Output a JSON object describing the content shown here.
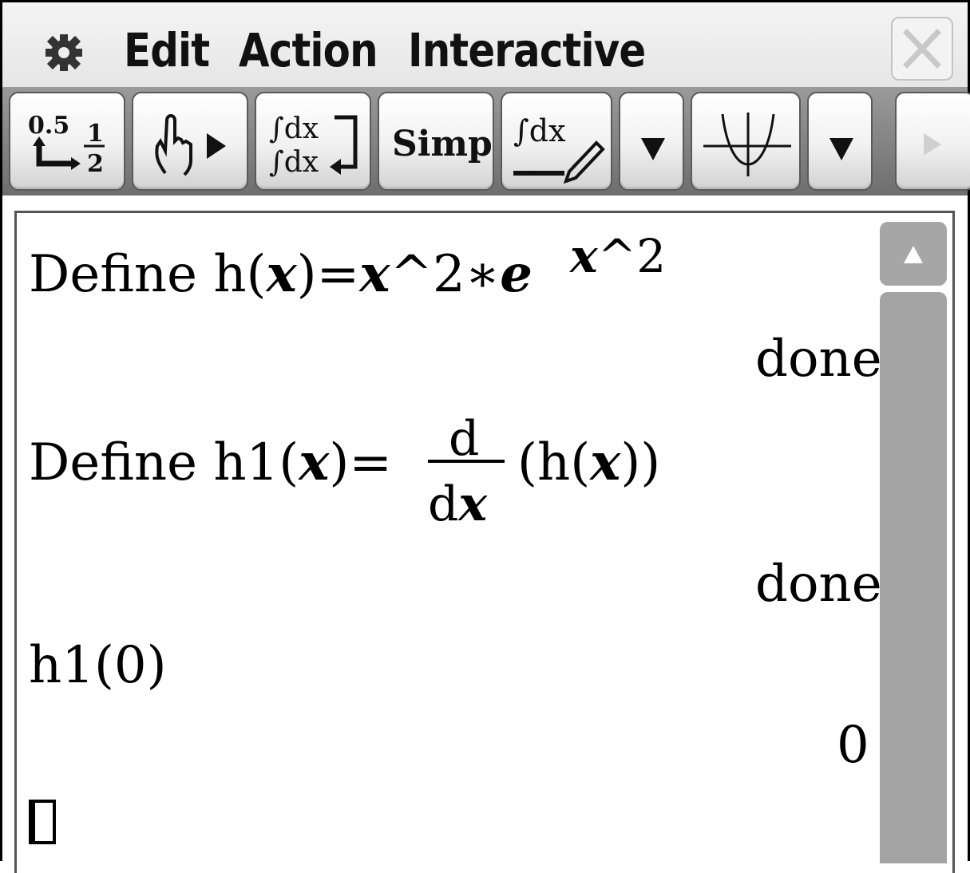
{
  "menu": {
    "settings_icon": "gear-icon",
    "items": [
      "Edit",
      "Action",
      "Interactive"
    ],
    "close_icon": "close-icon"
  },
  "toolbar": {
    "buttons": [
      {
        "name": "decimal-fraction-toggle-button",
        "label_top": "0.5",
        "label_frac_num": "1",
        "label_frac_den": "2"
      },
      {
        "name": "pan-hand-button"
      },
      {
        "name": "integral-toggle-button",
        "label_top": "∫dx",
        "label_bottom": "∫dx"
      },
      {
        "name": "simplify-button",
        "label": "Simp"
      },
      {
        "name": "integral-edit-button",
        "label": "∫dx"
      },
      {
        "name": "dropdown-arrow-1"
      },
      {
        "name": "graph-button"
      },
      {
        "name": "dropdown-arrow-2"
      },
      {
        "name": "toolbar-next-button"
      }
    ]
  },
  "history": {
    "entry1": {
      "prefix": "Define  h(",
      "x1": "x",
      "mid": ")=",
      "x2": "x",
      "tail": "^2∗",
      "e": "e",
      "sup_x": "x",
      "sup_tail": "^2",
      "result": "done"
    },
    "entry2": {
      "prefix": "Define  h1(",
      "x1": "x",
      "mid": ")=",
      "frac_num": "d",
      "frac_den_d": "d",
      "frac_den_x": "x",
      "tail_open": "(h(",
      "tail_x": "x",
      "tail_close": "))",
      "result": "done"
    },
    "entry3": {
      "input": "h1(0)",
      "result": "0"
    }
  },
  "colors": {
    "toolbar": "#7f7f7f",
    "scrollbar": "#a3a3a3",
    "menubar": "#eeeeee"
  }
}
